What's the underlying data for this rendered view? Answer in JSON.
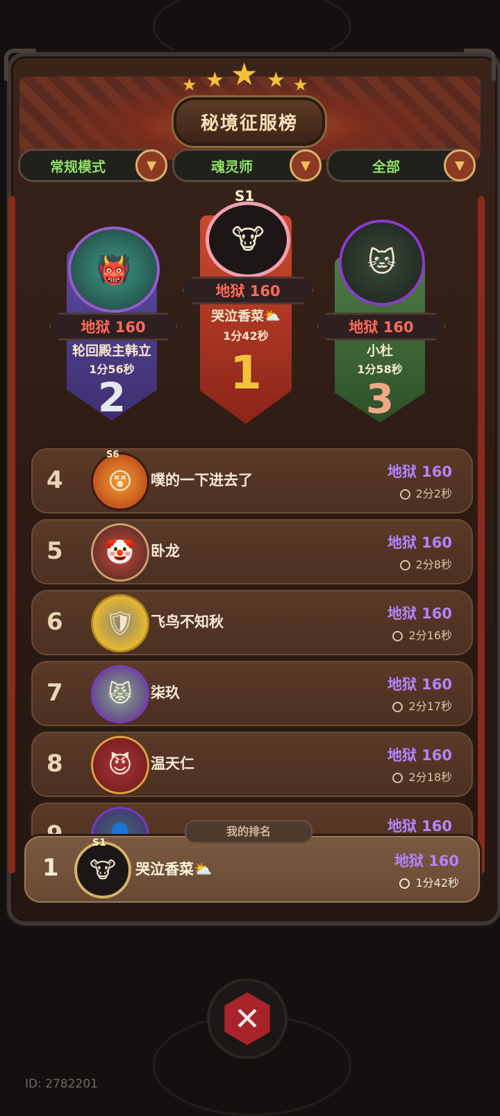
{
  "header": {
    "title": "秘境征服榜",
    "stars": [
      "★",
      "★",
      "★",
      "★",
      "★"
    ]
  },
  "filters": [
    {
      "label": "常规模式"
    },
    {
      "label": "魂灵师"
    },
    {
      "label": "全部"
    }
  ],
  "dropdown_glyph": "▼",
  "podium": [
    {
      "rank": "2",
      "score": "地狱 160",
      "name": "轮回殿主韩立",
      "time": "1分56秒",
      "color": "#4b3a82"
    },
    {
      "rank": "1",
      "badge": "S1",
      "score": "地狱 160",
      "name": "哭泣香菜⛅",
      "time": "1分42秒",
      "color": "#b3321f"
    },
    {
      "rank": "3",
      "score": "地狱 160",
      "name": "小杜",
      "time": "1分58秒",
      "color": "#3f6a3a"
    }
  ],
  "rows": [
    {
      "rank": "4",
      "name": "噗的一下进去了",
      "score": "地狱 160",
      "time": "2分2秒",
      "badge": "S6"
    },
    {
      "rank": "5",
      "name": "卧龙",
      "score": "地狱 160",
      "time": "2分8秒"
    },
    {
      "rank": "6",
      "name": "飞鸟不知秋",
      "score": "地狱 160",
      "time": "2分16秒"
    },
    {
      "rank": "7",
      "name": "柒玖",
      "score": "地狱 160",
      "time": "2分17秒"
    },
    {
      "rank": "8",
      "name": "温天仁",
      "score": "地狱 160",
      "time": "2分18秒"
    },
    {
      "rank": "9",
      "name": "",
      "score": "地狱 160",
      "time": ""
    }
  ],
  "my_rank": {
    "tab_label": "我的排名",
    "rank": "1",
    "badge": "S1",
    "name": "哭泣香菜⛅",
    "score": "地狱 160",
    "time": "1分42秒"
  },
  "close_glyph": "✕",
  "player_id": "ID: 2782201"
}
